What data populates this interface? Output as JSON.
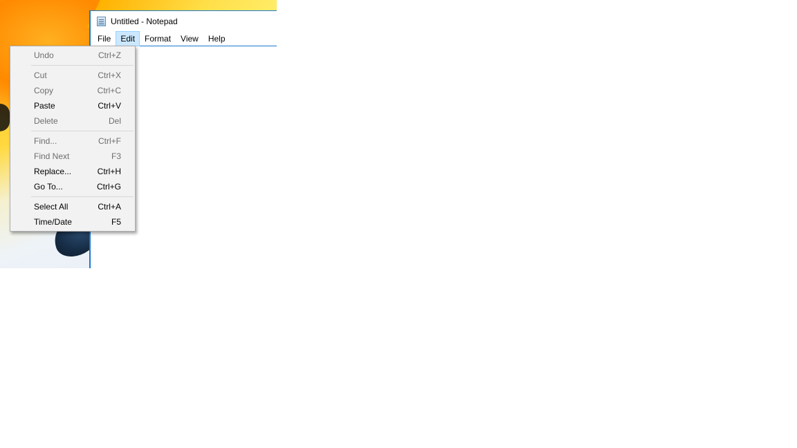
{
  "window": {
    "title": "Untitled - Notepad",
    "icon": "notepad-icon"
  },
  "menubar": [
    {
      "label": "File",
      "active": false
    },
    {
      "label": "Edit",
      "active": true
    },
    {
      "label": "Format",
      "active": false
    },
    {
      "label": "View",
      "active": false
    },
    {
      "label": "Help",
      "active": false
    }
  ],
  "edit_menu": {
    "undo": {
      "label": "Undo",
      "shortcut": "Ctrl+Z",
      "enabled": false
    },
    "cut": {
      "label": "Cut",
      "shortcut": "Ctrl+X",
      "enabled": false
    },
    "copy": {
      "label": "Copy",
      "shortcut": "Ctrl+C",
      "enabled": false
    },
    "paste": {
      "label": "Paste",
      "shortcut": "Ctrl+V",
      "enabled": true
    },
    "delete": {
      "label": "Delete",
      "shortcut": "Del",
      "enabled": false
    },
    "find": {
      "label": "Find...",
      "shortcut": "Ctrl+F",
      "enabled": false
    },
    "find_next": {
      "label": "Find Next",
      "shortcut": "F3",
      "enabled": false
    },
    "replace": {
      "label": "Replace...",
      "shortcut": "Ctrl+H",
      "enabled": true
    },
    "goto": {
      "label": "Go To...",
      "shortcut": "Ctrl+G",
      "enabled": true
    },
    "select_all": {
      "label": "Select All",
      "shortcut": "Ctrl+A",
      "enabled": true
    },
    "time_date": {
      "label": "Time/Date",
      "shortcut": "F5",
      "enabled": true
    }
  },
  "colors": {
    "accent_border": "#1b78d0",
    "menu_highlight": "#cce8ff",
    "disabled_text": "#6d6d6d"
  }
}
